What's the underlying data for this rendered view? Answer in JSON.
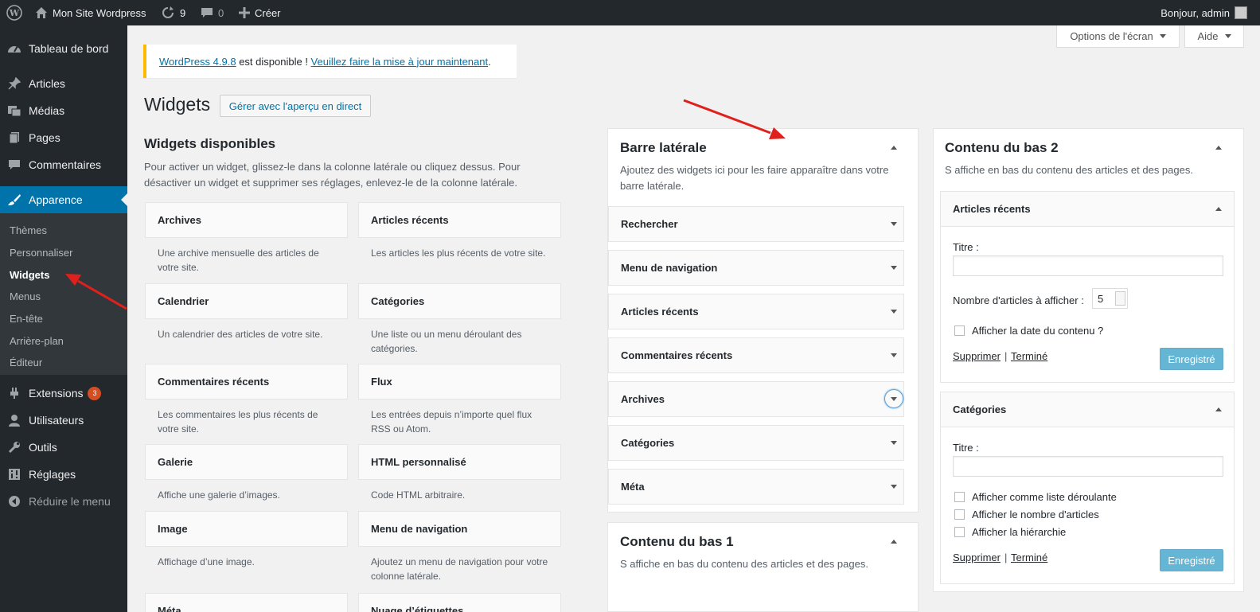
{
  "adminbar": {
    "site_name": "Mon Site Wordpress",
    "updates_count": "9",
    "comments_count": "0",
    "new_label": "Créer",
    "greeting": "Bonjour, admin"
  },
  "sidebar": {
    "items": [
      {
        "label": "Tableau de bord"
      },
      {
        "label": "Articles"
      },
      {
        "label": "Médias"
      },
      {
        "label": "Pages"
      },
      {
        "label": "Commentaires"
      },
      {
        "label": "Apparence"
      },
      {
        "label": "Extensions",
        "badge": "3"
      },
      {
        "label": "Utilisateurs"
      },
      {
        "label": "Outils"
      },
      {
        "label": "Réglages"
      },
      {
        "label": "Réduire le menu"
      }
    ],
    "submenu": [
      "Thèmes",
      "Personnaliser",
      "Widgets",
      "Menus",
      "En-tête",
      "Arrière-plan",
      "Éditeur"
    ]
  },
  "screen_options": {
    "options_label": "Options de l'écran",
    "help_label": "Aide"
  },
  "notice": {
    "version_link": "WordPress 4.9.8",
    "middle": " est disponible ! ",
    "update_link": "Veuillez faire la mise à jour maintenant",
    "end": "."
  },
  "page": {
    "title": "Widgets",
    "live_preview_button": "Gérer avec l'aperçu en direct"
  },
  "available": {
    "title": "Widgets disponibles",
    "description": "Pour activer un widget, glissez-le dans la colonne latérale ou cliquez dessus. Pour désactiver un widget et supprimer ses réglages, enlevez-le de la colonne latérale.",
    "widgets": [
      {
        "title": "Archives",
        "desc": "Une archive mensuelle des articles de votre site."
      },
      {
        "title": "Articles récents",
        "desc": "Les articles les plus récents de votre site."
      },
      {
        "title": "Calendrier",
        "desc": "Un calendrier des articles de votre site."
      },
      {
        "title": "Catégories",
        "desc": "Une liste ou un menu déroulant des catégories."
      },
      {
        "title": "Commentaires récents",
        "desc": "Les commentaires les plus récents de votre site."
      },
      {
        "title": "Flux",
        "desc": "Les entrées depuis n’importe quel flux RSS ou Atom."
      },
      {
        "title": "Galerie",
        "desc": "Affiche une galerie d’images."
      },
      {
        "title": "HTML personnalisé",
        "desc": "Code HTML arbitraire."
      },
      {
        "title": "Image",
        "desc": "Affichage d’une image."
      },
      {
        "title": "Menu de navigation",
        "desc": "Ajoutez un menu de navigation pour votre colonne latérale."
      },
      {
        "title": "Méta",
        "desc": ""
      },
      {
        "title": "Nuage d’étiquettes",
        "desc": ""
      }
    ]
  },
  "sidebar_area": {
    "title": "Barre latérale",
    "description": "Ajoutez des widgets ici pour les faire apparaître dans votre barre latérale.",
    "widgets": [
      "Rechercher",
      "Menu de navigation",
      "Articles récents",
      "Commentaires récents",
      "Archives",
      "Catégories",
      "Méta"
    ]
  },
  "bottom1": {
    "title": "Contenu du bas 1",
    "description": "S affiche en bas du contenu des articles et des pages."
  },
  "bottom2": {
    "title": "Contenu du bas 2",
    "description": "S affiche en bas du contenu des articles et des pages.",
    "recent": {
      "title": "Articles récents",
      "title_label": "Titre :",
      "title_value": "",
      "count_label": "Nombre d'articles à afficher :",
      "count_value": "5",
      "show_date_label": "Afficher la date du contenu ?",
      "delete_label": "Supprimer",
      "sep": "|",
      "done_label": "Terminé",
      "saved_label": "Enregistré"
    },
    "categories": {
      "title": "Catégories",
      "title_label": "Titre :",
      "title_value": "",
      "opt_dropdown": "Afficher comme liste déroulante",
      "opt_count": "Afficher le nombre d'articles",
      "opt_hierarchy": "Afficher la hiérarchie",
      "delete_label": "Supprimer",
      "sep": "|",
      "done_label": "Terminé",
      "saved_label": "Enregistré"
    }
  },
  "colors": {
    "adminbar": "#23282d",
    "accent": "#0073aa",
    "notice": "#ffb900",
    "arrow": "#e0201c"
  },
  "icons": [
    "wordpress-icon",
    "home-icon",
    "updates-icon",
    "comments-icon",
    "plus-icon",
    "avatar-icon",
    "dashboard-icon",
    "pin-icon",
    "media-icon",
    "pages-icon",
    "comment-icon",
    "brush-icon",
    "plugin-icon",
    "user-icon",
    "wrench-icon",
    "sliders-icon",
    "collapse-icon"
  ]
}
